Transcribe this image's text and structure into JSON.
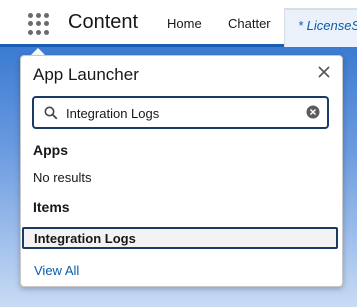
{
  "navbar": {
    "app_name": "Content",
    "items": [
      {
        "label": "Home"
      },
      {
        "label": "Chatter"
      }
    ],
    "active_tab": "* LicenseS"
  },
  "launcher": {
    "title": "App Launcher",
    "close_icon": "close-icon",
    "search": {
      "value": "Integration Logs",
      "icon": "search-icon",
      "clear_icon": "clear-icon"
    },
    "apps": {
      "title": "Apps",
      "empty_text": "No results"
    },
    "items": {
      "title": "Items",
      "results": [
        {
          "label": "Integration Logs"
        }
      ]
    },
    "view_all": "View All"
  },
  "colors": {
    "accent": "#1b5fb3",
    "link": "#0b5cab",
    "focus_border": "#1b3a66"
  }
}
